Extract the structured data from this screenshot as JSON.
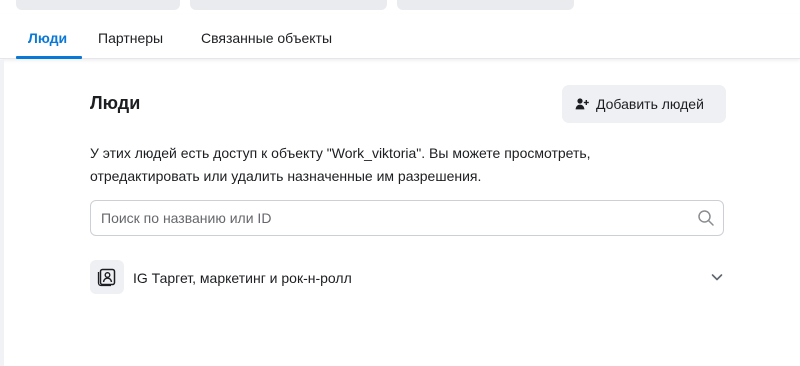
{
  "tabs": [
    {
      "label": "Люди",
      "active": true
    },
    {
      "label": "Партнеры",
      "active": false
    },
    {
      "label": "Связанные объекты",
      "active": false
    }
  ],
  "section": {
    "title": "Люди",
    "add_button_label": "Добавить людей",
    "add_button_icon": "add-person-icon",
    "description_line1": "У этих людей есть доступ к объекту \"Work_viktoria\". Вы можете просмотреть,",
    "description_line2": "отредактировать или удалить назначенные им разрешения."
  },
  "search": {
    "placeholder": "Поиск по названию или ID",
    "value": "",
    "icon": "search-icon"
  },
  "people_list": [
    {
      "name": "IG Таргет, маркетинг и рок-н-ролл",
      "icon": "person-card-icon",
      "expand_icon": "chevron-down-icon"
    }
  ],
  "colors": {
    "accent": "#0a78d7",
    "button_bg": "#eef0f3",
    "border": "#ccd0d5",
    "text": "#1c1e21"
  }
}
